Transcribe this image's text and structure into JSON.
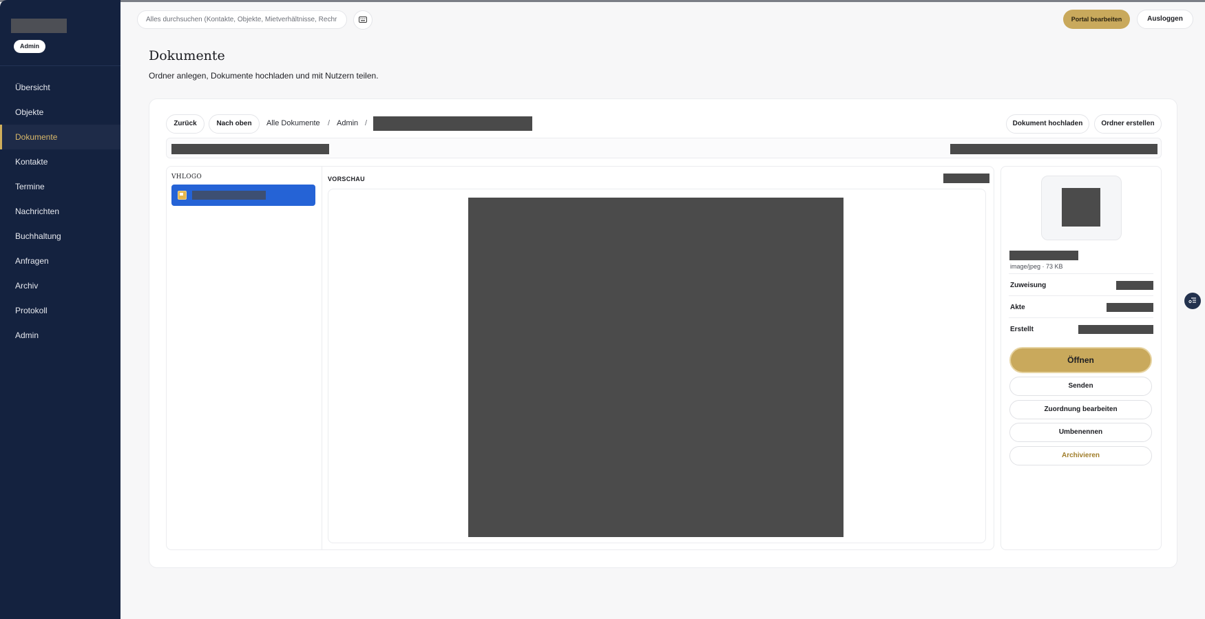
{
  "sidebar": {
    "badge": "Admin",
    "items": [
      {
        "label": "Übersicht",
        "active": false
      },
      {
        "label": "Objekte",
        "active": false
      },
      {
        "label": "Dokumente",
        "active": true
      },
      {
        "label": "Kontakte",
        "active": false
      },
      {
        "label": "Termine",
        "active": false
      },
      {
        "label": "Nachrichten",
        "active": false
      },
      {
        "label": "Buchhaltung",
        "active": false
      },
      {
        "label": "Anfragen",
        "active": false
      },
      {
        "label": "Archiv",
        "active": false
      },
      {
        "label": "Protokoll",
        "active": false
      },
      {
        "label": "Admin",
        "active": false
      }
    ]
  },
  "topbar": {
    "search_placeholder": "Alles durchsuchen (Kontakte, Objekte, Mietverhältnisse, Rechr",
    "keyboard_icon": "keyboard-icon",
    "edit_portal": "Portal bearbeiten",
    "logout": "Ausloggen"
  },
  "page": {
    "title": "Dokumente",
    "subtitle": "Ordner anlegen, Dokumente hochladen und mit Nutzern teilen."
  },
  "toolbar": {
    "back": "Zurück",
    "up": "Nach oben",
    "crumbs": [
      "Alle Dokumente",
      "Admin"
    ],
    "separator": "/",
    "upload": "Dokument hochladen",
    "create_folder": "Ordner erstellen"
  },
  "tree": {
    "title": "VHLOGO"
  },
  "preview": {
    "label": "VORSCHAU"
  },
  "details": {
    "meta": "image/jpeg · 73 KB",
    "rows": [
      "Zuweisung",
      "Akte",
      "Erstellt"
    ],
    "open": "Öffnen",
    "send": "Senden",
    "edit_assignment": "Zuordnung bearbeiten",
    "rename": "Umbenennen",
    "archive": "Archivieren"
  },
  "colors": {
    "sidebar_bg": "#14223f",
    "accent_gold": "#c9a95c",
    "selection_blue": "#2563d6"
  }
}
